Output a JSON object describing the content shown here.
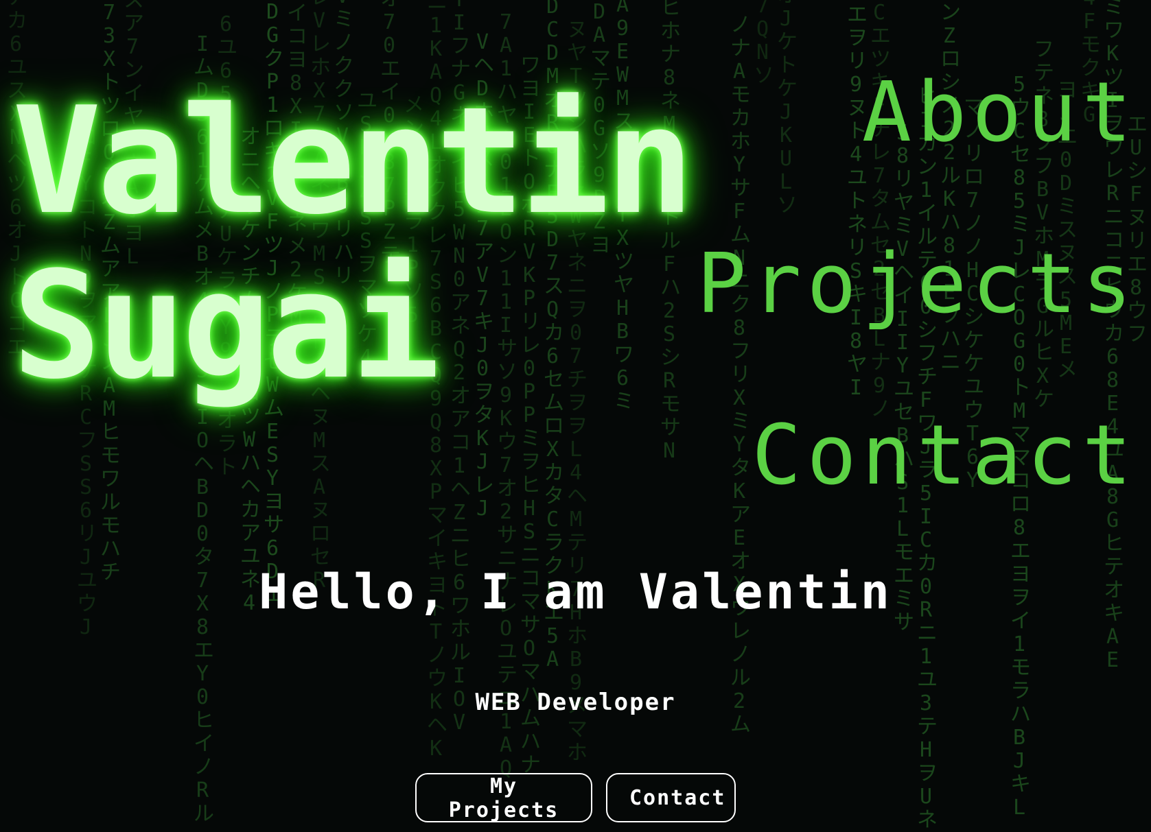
{
  "brand": {
    "first_name": "Valentin",
    "last_name": "Sugai"
  },
  "nav": {
    "items": [
      {
        "label": "About"
      },
      {
        "label": "Projects"
      },
      {
        "label": "Contact"
      }
    ]
  },
  "hero": {
    "greeting": "Hello, I am Valentin",
    "role": "WEB Developer",
    "buttons": {
      "projects": "My Projects",
      "contact": "Contact"
    }
  },
  "theme": {
    "background": "#050807",
    "nav_green": "#5bd144",
    "glow_green": "#4cff2a",
    "rain_green": "#2a6f2a",
    "text_white": "#ffffff"
  }
}
